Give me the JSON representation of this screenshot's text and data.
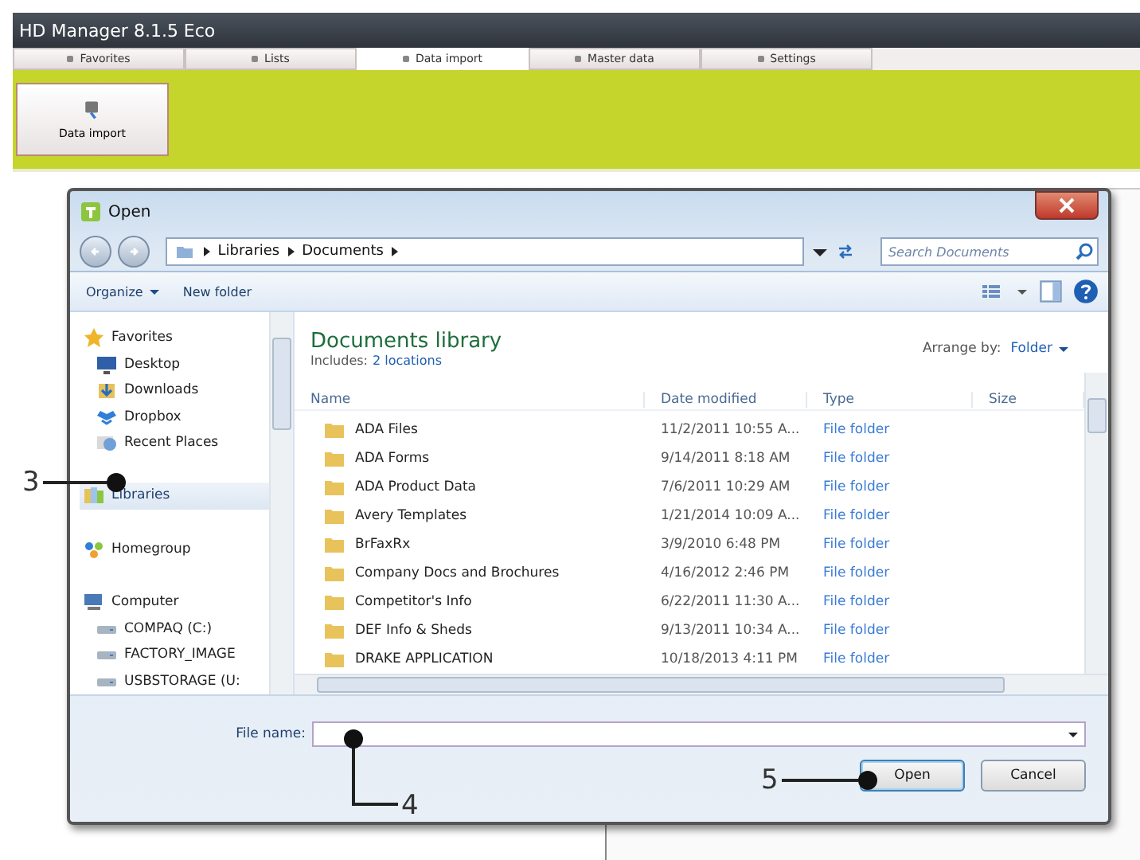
{
  "app": {
    "title": "HD Manager 8.1.5 Eco",
    "tabs": [
      {
        "label": "Favorites",
        "selected": false
      },
      {
        "label": "Lists",
        "selected": false
      },
      {
        "label": "Data import",
        "selected": true
      },
      {
        "label": "Master data",
        "selected": false
      },
      {
        "label": "Settings",
        "selected": false
      }
    ],
    "ribbon_buttons": [
      {
        "label": "Data import"
      }
    ]
  },
  "dialog": {
    "title": "Open",
    "breadcrumb": [
      "Libraries",
      "Documents"
    ],
    "search": {
      "placeholder": "Search Documents"
    },
    "toolbar": [
      {
        "label": "Organize",
        "menu": true
      },
      {
        "label": "New folder",
        "menu": false
      }
    ],
    "nav": [
      {
        "label": "Favorites",
        "kind": "star",
        "selected": false,
        "children": [
          {
            "label": "Desktop",
            "kind": "desktop",
            "selected": false
          },
          {
            "label": "Downloads",
            "kind": "download",
            "selected": false
          },
          {
            "label": "Dropbox",
            "kind": "box",
            "selected": false
          },
          {
            "label": "Recent Places",
            "kind": "recent",
            "selected": false
          }
        ]
      },
      {
        "label": "Libraries",
        "kind": "library",
        "selected": true
      },
      {
        "label": "Homegroup",
        "kind": "homegroup",
        "selected": false
      },
      {
        "label": "Computer",
        "kind": "computer",
        "selected": false,
        "children": [
          {
            "label": "COMPAQ (C:)",
            "kind": "drive",
            "selected": false
          },
          {
            "label": "FACTORY_IMAGE",
            "kind": "drive",
            "selected": false
          },
          {
            "label": "USBSTORAGE (U:",
            "kind": "drive",
            "selected": false
          }
        ]
      }
    ],
    "library": {
      "title": "Documents library",
      "includes_label": "Includes:",
      "locations": "2 locations",
      "arrange_label": "Arrange by:",
      "arrange_value": "Folder"
    },
    "columns": [
      "Name",
      "Date modified",
      "Type",
      "Size"
    ],
    "rows": [
      {
        "name": "ADA Files",
        "date": "11/2/2011 10:55 A...",
        "type": "File folder"
      },
      {
        "name": "ADA Forms",
        "date": "9/14/2011 8:18 AM",
        "type": "File folder"
      },
      {
        "name": "ADA Product Data",
        "date": "7/6/2011 10:29 AM",
        "type": "File folder"
      },
      {
        "name": "Avery Templates",
        "date": "1/21/2014 10:09 A...",
        "type": "File folder"
      },
      {
        "name": "BrFaxRx",
        "date": "3/9/2010 6:48 PM",
        "type": "File folder"
      },
      {
        "name": "Company Docs and Brochures",
        "date": "4/16/2012 2:46 PM",
        "type": "File folder"
      },
      {
        "name": "Competitor's Info",
        "date": "6/22/2011 11:30 A...",
        "type": "File folder"
      },
      {
        "name": "DEF Info & Sheds",
        "date": "9/13/2011 10:34 A...",
        "type": "File folder"
      },
      {
        "name": "DRAKE APPLICATION",
        "date": "10/18/2013 4:11 PM",
        "type": "File folder"
      }
    ],
    "file_name": {
      "label": "File name:"
    },
    "buttons": [
      {
        "label": "Open",
        "default": true
      },
      {
        "label": "Cancel",
        "default": false
      }
    ]
  },
  "callouts": [
    {
      "label": "3"
    },
    {
      "label": "4"
    },
    {
      "label": "5"
    }
  ]
}
